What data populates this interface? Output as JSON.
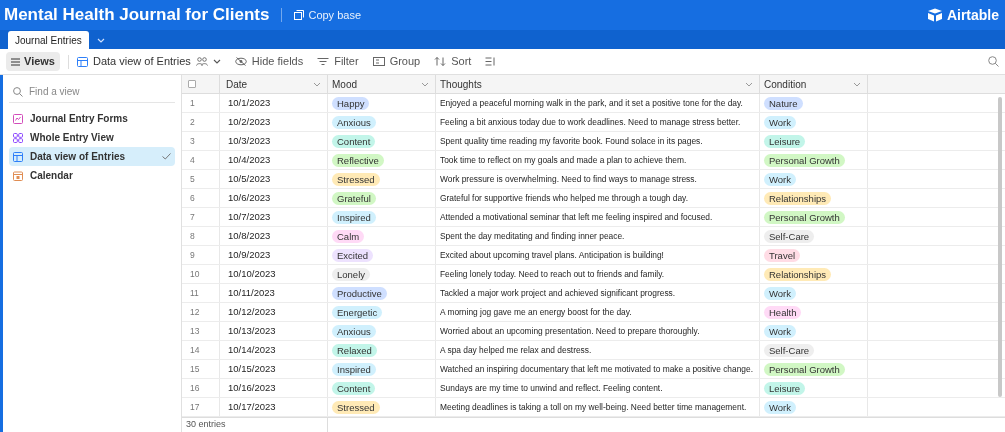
{
  "header": {
    "title": "Mental Health Journal for Clients",
    "copy_button": "Copy base",
    "logo": "Airtable"
  },
  "tabs": [
    {
      "label": "Journal Entries",
      "selected": true
    }
  ],
  "toolbar": {
    "views_button": "Views",
    "current_view": "Data view of Entries",
    "buttons": [
      {
        "kind": "hide",
        "label": "Hide fields"
      },
      {
        "kind": "filter",
        "label": "Filter"
      },
      {
        "kind": "group",
        "label": "Group"
      },
      {
        "kind": "sort",
        "label": "Sort"
      }
    ]
  },
  "sidebar": {
    "search": {
      "placeholder": "Find a view"
    },
    "items": [
      {
        "kind": "form",
        "label": "Journal Entry Forms",
        "selected": false
      },
      {
        "kind": "gallery",
        "label": "Whole Entry View",
        "selected": false
      },
      {
        "kind": "grid",
        "label": "Data view of Entries",
        "selected": true
      },
      {
        "kind": "calendar",
        "label": "Calendar",
        "selected": false
      }
    ]
  },
  "table": {
    "select_all": {
      "checked": false
    },
    "columns": [
      "Date",
      "Mood",
      "Thoughts",
      "Condition"
    ],
    "rows": [
      {
        "number": "1",
        "date": "10/1/2023",
        "mood": {
          "text": "Happy",
          "color": "#cfdfff"
        },
        "thoughts": "Enjoyed a peaceful morning walk in the park, and it set a positive tone for the day.",
        "condition": {
          "text": "Nature",
          "color": "#cfdfff"
        }
      },
      {
        "number": "2",
        "date": "10/2/2023",
        "mood": {
          "text": "Anxious",
          "color": "#d0f0fd"
        },
        "thoughts": "Feeling a bit anxious today due to work deadlines. Need to manage stress better.",
        "condition": {
          "text": "Work",
          "color": "#d0f0fd"
        }
      },
      {
        "number": "3",
        "date": "10/3/2023",
        "mood": {
          "text": "Content",
          "color": "#c2f5e9"
        },
        "thoughts": "Spent quality time reading my favorite book. Found solace in its pages.",
        "condition": {
          "text": "Leisure",
          "color": "#c2f5e9"
        }
      },
      {
        "number": "4",
        "date": "10/4/2023",
        "mood": {
          "text": "Reflective",
          "color": "#d1f7c4"
        },
        "thoughts": "Took time to reflect on my goals and made a plan to achieve them.",
        "condition": {
          "text": "Personal Growth",
          "color": "#d1f7c4"
        }
      },
      {
        "number": "5",
        "date": "10/5/2023",
        "mood": {
          "text": "Stressed",
          "color": "#ffeab6"
        },
        "thoughts": "Work pressure is overwhelming. Need to find ways to manage stress.",
        "condition": {
          "text": "Work",
          "color": "#d0f0fd"
        }
      },
      {
        "number": "6",
        "date": "10/6/2023",
        "mood": {
          "text": "Grateful",
          "color": "#d1f7c4"
        },
        "thoughts": "Grateful for supportive friends who helped me through a tough day.",
        "condition": {
          "text": "Relationships",
          "color": "#ffeab6"
        }
      },
      {
        "number": "7",
        "date": "10/7/2023",
        "mood": {
          "text": "Inspired",
          "color": "#d0f0fd"
        },
        "thoughts": "Attended a motivational seminar that left me feeling inspired and focused.",
        "condition": {
          "text": "Personal Growth",
          "color": "#d1f7c4"
        }
      },
      {
        "number": "8",
        "date": "10/8/2023",
        "mood": {
          "text": "Calm",
          "color": "#ffdaf6"
        },
        "thoughts": "Spent the day meditating and finding inner peace.",
        "condition": {
          "text": "Self-Care",
          "color": "#eeeeee"
        }
      },
      {
        "number": "9",
        "date": "10/9/2023",
        "mood": {
          "text": "Excited",
          "color": "#ede2fe"
        },
        "thoughts": "Excited about upcoming travel plans. Anticipation is building!",
        "condition": {
          "text": "Travel",
          "color": "#ffdce5"
        }
      },
      {
        "number": "10",
        "date": "10/10/2023",
        "mood": {
          "text": "Lonely",
          "color": "#eeeeee"
        },
        "thoughts": "Feeling lonely today. Need to reach out to friends and family.",
        "condition": {
          "text": "Relationships",
          "color": "#ffeab6"
        }
      },
      {
        "number": "11",
        "date": "10/11/2023",
        "mood": {
          "text": "Productive",
          "color": "#cfdfff"
        },
        "thoughts": "Tackled a major work project and achieved significant progress.",
        "condition": {
          "text": "Work",
          "color": "#d0f0fd"
        }
      },
      {
        "number": "12",
        "date": "10/12/2023",
        "mood": {
          "text": "Energetic",
          "color": "#d0f0fd"
        },
        "thoughts": "A morning jog gave me an energy boost for the day.",
        "condition": {
          "text": "Health",
          "color": "#ffdaf6"
        }
      },
      {
        "number": "13",
        "date": "10/13/2023",
        "mood": {
          "text": "Anxious",
          "color": "#d0f0fd"
        },
        "thoughts": "Worried about an upcoming presentation. Need to prepare thoroughly.",
        "condition": {
          "text": "Work",
          "color": "#d0f0fd"
        }
      },
      {
        "number": "14",
        "date": "10/14/2023",
        "mood": {
          "text": "Relaxed",
          "color": "#c2f5e9"
        },
        "thoughts": "A spa day helped me relax and destress.",
        "condition": {
          "text": "Self-Care",
          "color": "#eeeeee"
        }
      },
      {
        "number": "15",
        "date": "10/15/2023",
        "mood": {
          "text": "Inspired",
          "color": "#d0f0fd"
        },
        "thoughts": "Watched an inspiring documentary that left me motivated to make a positive change.",
        "condition": {
          "text": "Personal Growth",
          "color": "#d1f7c4"
        }
      },
      {
        "number": "16",
        "date": "10/16/2023",
        "mood": {
          "text": "Content",
          "color": "#c2f5e9"
        },
        "thoughts": "Sundays are my time to unwind and reflect. Feeling content.",
        "condition": {
          "text": "Leisure",
          "color": "#c2f5e9"
        }
      },
      {
        "number": "17",
        "date": "10/17/2023",
        "mood": {
          "text": "Stressed",
          "color": "#ffeab6"
        },
        "thoughts": "Meeting deadlines is taking a toll on my well-being. Need better time management.",
        "condition": {
          "text": "Work",
          "color": "#d0f0fd"
        }
      }
    ]
  },
  "footer": {
    "record_count": "30 entries"
  }
}
